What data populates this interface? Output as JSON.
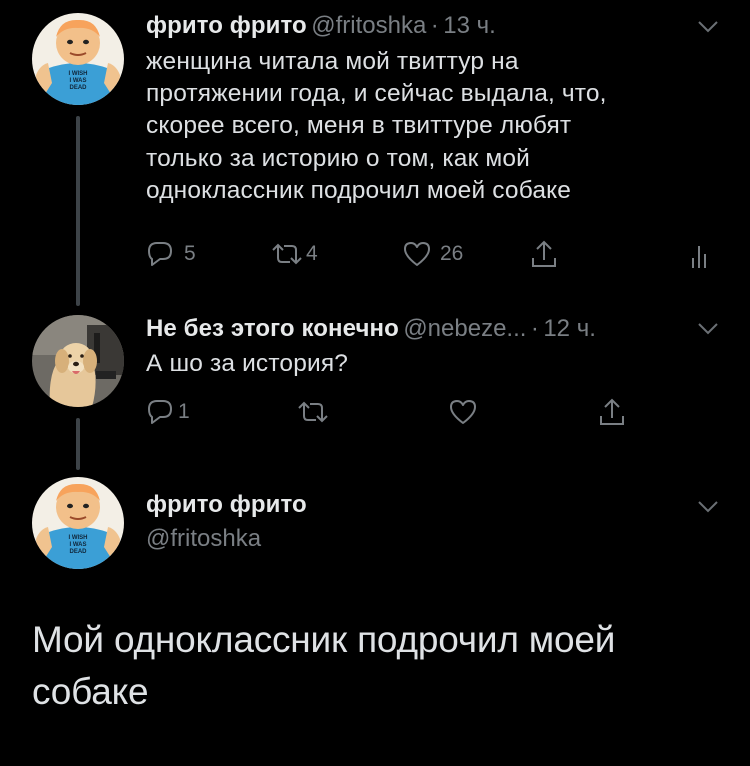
{
  "colors": {
    "background": "#000000",
    "text": "#e7e9ea",
    "secondary": "#7a7f84",
    "thread_line": "#3d4348",
    "avatar_shirt": "#3b9fd6"
  },
  "tweet1": {
    "name": "фрито фрито",
    "handle": "@fritoshka",
    "sep": "·",
    "time": "13 ч.",
    "text": "женщина читала мой твиттур на\nпротяжении года, и сейчас выдала, что,\nскорее всего, меня в твиттуре любят\nтолько за историю о том, как мой\nодноклассник подрочил моей собаке",
    "avatar_shirt_text": "I WISH\nI WAS\nDEAD",
    "replies": "5",
    "retweets": "4",
    "likes": "26",
    "icons": [
      "reply-icon",
      "retweet-icon",
      "like-icon",
      "share-icon",
      "analytics-icon",
      "chevron-down-icon"
    ]
  },
  "tweet2": {
    "name": "Не без этого конечно",
    "handle": "@nebeze...",
    "sep": "·",
    "time": "12 ч.",
    "text": "А шо за история?",
    "replies": "1",
    "retweets": "",
    "likes": "",
    "icons": [
      "reply-icon",
      "retweet-icon",
      "like-icon",
      "share-icon",
      "chevron-down-icon"
    ]
  },
  "tweet3": {
    "name": "фрито фрито",
    "handle": "@fritoshka",
    "avatar_shirt_text": "I WISH\nI WAS\nDEAD",
    "text": "Мой одноклассник подрочил моей\nсобаке"
  }
}
